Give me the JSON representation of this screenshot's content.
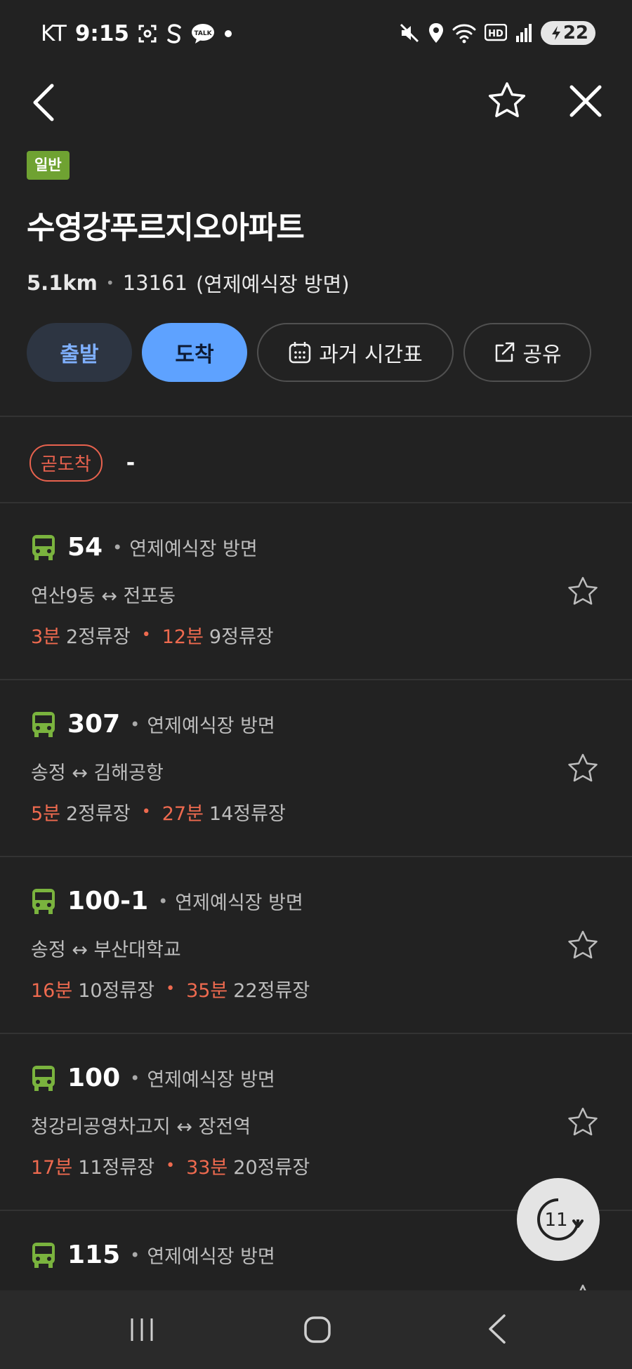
{
  "status_bar": {
    "carrier": "KT",
    "time": "9:15",
    "battery": "22",
    "icons_left": [
      "screenshot-icon",
      "samsung-s-icon",
      "kakaotalk-icon",
      "dot-icon"
    ],
    "icons_right": [
      "mute-icon",
      "location-icon",
      "wifi-icon",
      "hd-icon",
      "signal-icon",
      "battery-icon"
    ]
  },
  "header": {
    "badge": "일반",
    "title": "수영강푸르지오아파트",
    "distance": "5.1km",
    "stop_id": "13161",
    "direction": "(연제예식장 방면)"
  },
  "actions": {
    "depart": "출발",
    "arrive": "도착",
    "timetable": "과거 시간표",
    "share": "공유"
  },
  "soon_arrival": {
    "label": "곧도착",
    "value": "-"
  },
  "routes": [
    {
      "number": "54",
      "direction": "연제예식장 방면",
      "path": "연산9동 ↔ 전포동",
      "first_time": "3분",
      "first_stops": "2정류장",
      "second_time": "12분",
      "second_stops": "9정류장"
    },
    {
      "number": "307",
      "direction": "연제예식장 방면",
      "path": "송정 ↔ 김해공항",
      "first_time": "5분",
      "first_stops": "2정류장",
      "second_time": "27분",
      "second_stops": "14정류장"
    },
    {
      "number": "100-1",
      "direction": "연제예식장 방면",
      "path": "송정 ↔ 부산대학교",
      "first_time": "16분",
      "first_stops": "10정류장",
      "second_time": "35분",
      "second_stops": "22정류장"
    },
    {
      "number": "100",
      "direction": "연제예식장 방면",
      "path": "청강리공영차고지 ↔ 장전역",
      "first_time": "17분",
      "first_stops": "11정류장",
      "second_time": "33분",
      "second_stops": "20정류장"
    },
    {
      "number": "115",
      "direction": "연제예식장 방면"
    }
  ],
  "refresh": {
    "countdown": "11"
  },
  "colors": {
    "background": "#222222",
    "general_badge": "#6fa232",
    "arrive_button": "#5ea2ff",
    "depart_button": "#2d3542",
    "time_highlight": "#ee6a4f",
    "bus_icon": "#7ab33e"
  }
}
